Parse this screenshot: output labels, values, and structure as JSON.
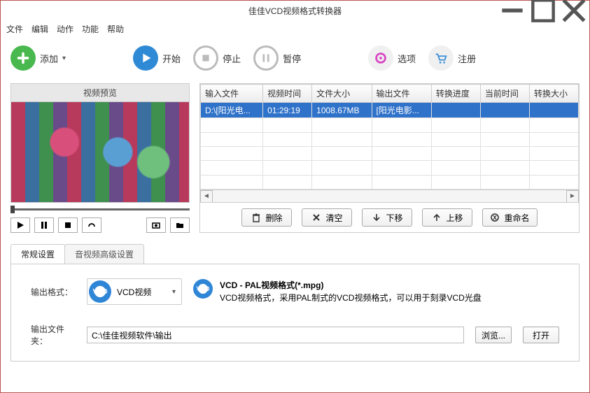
{
  "title": "佳佳VCD视频格式转换器",
  "menu": [
    "文件",
    "编辑",
    "动作",
    "功能",
    "帮助"
  ],
  "toolbar": {
    "add": "添加",
    "start": "开始",
    "stop": "停止",
    "pause": "暂停",
    "options": "选项",
    "register": "注册"
  },
  "preview": {
    "title": "视频预览"
  },
  "table": {
    "headers": [
      "输入文件",
      "视频时间",
      "文件大小",
      "输出文件",
      "转换进度",
      "当前时间",
      "转换大小"
    ],
    "rows": [
      {
        "input": "D:\\[阳光电...",
        "duration": "01:29:19",
        "size": "1008.67MB",
        "output": "[阳光电影...",
        "progress": "",
        "curtime": "",
        "outsize": ""
      }
    ]
  },
  "actions": {
    "delete": "删除",
    "clear": "清空",
    "movedown": "下移",
    "moveup": "上移",
    "rename": "重命名"
  },
  "tabs": {
    "general": "常规设置",
    "advanced": "音视频高级设置"
  },
  "settings": {
    "format_label": "输出格式：",
    "format_select": "VCD视频",
    "format_title": "VCD - PAL视频格式(*.mpg)",
    "format_desc": "VCD视频格式，采用PAL制式的VCD视频格式，可以用于刻录VCD光盘",
    "folder_label": "输出文件夹：",
    "folder_value": "C:\\佳佳视频软件\\输出",
    "browse": "浏览...",
    "open": "打开"
  }
}
